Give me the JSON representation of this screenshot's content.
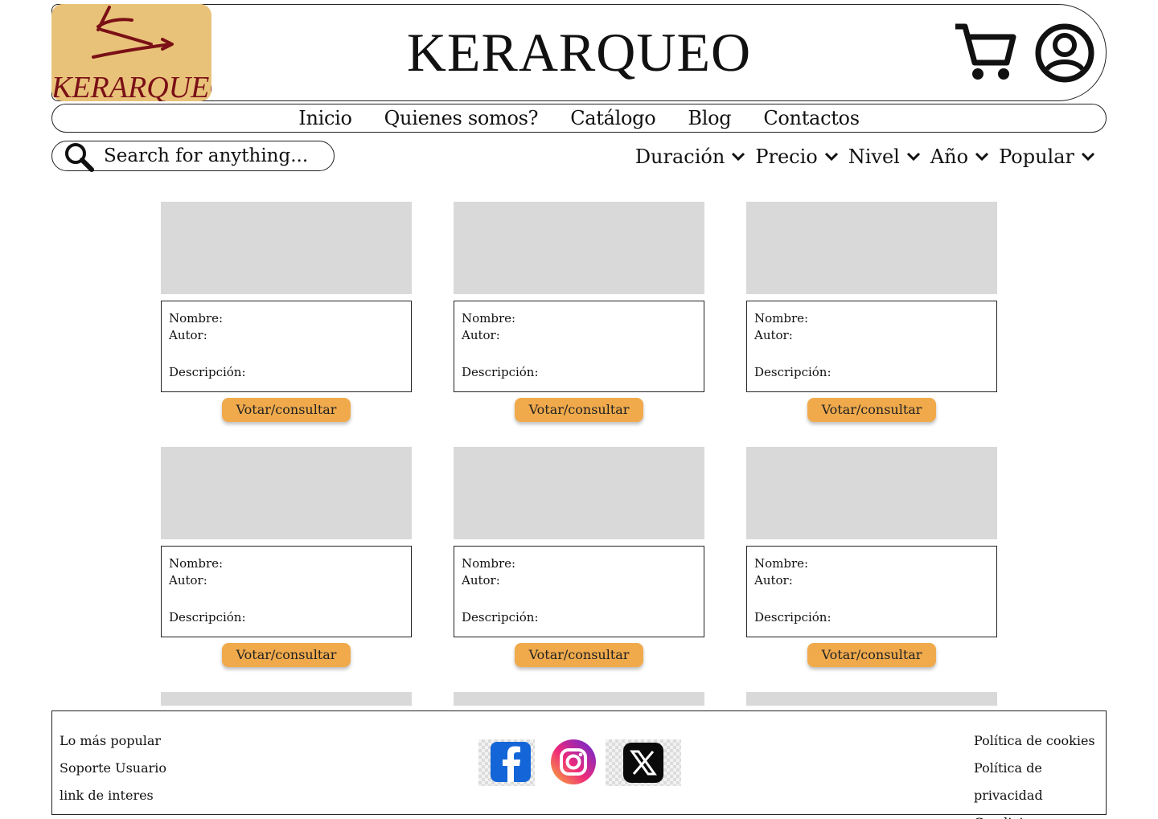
{
  "header": {
    "logo_text": "KERARQUEO",
    "title": "KERARQUEO",
    "cart_icon": "cart-icon",
    "account_icon": "account-icon"
  },
  "nav": {
    "items": [
      {
        "label": "Inicio"
      },
      {
        "label": "Quienes somos?"
      },
      {
        "label": "Catálogo"
      },
      {
        "label": "Blog"
      },
      {
        "label": "Contactos"
      }
    ]
  },
  "search": {
    "placeholder": "Search for anything...",
    "icon": "search-icon"
  },
  "filters": [
    {
      "label": "Duración"
    },
    {
      "label": "Precio"
    },
    {
      "label": "Nivel"
    },
    {
      "label": "Año"
    },
    {
      "label": "Popular"
    }
  ],
  "cards": [
    {
      "name_label": "Nombre:",
      "author_label": "Autor:",
      "desc_label": "Descripción:",
      "button": "Votar/consultar"
    },
    {
      "name_label": "Nombre:",
      "author_label": "Autor:",
      "desc_label": "Descripción:",
      "button": "Votar/consultar"
    },
    {
      "name_label": "Nombre:",
      "author_label": "Autor:",
      "desc_label": "Descripción:",
      "button": "Votar/consultar"
    },
    {
      "name_label": "Nombre:",
      "author_label": "Autor:",
      "desc_label": "Descripción:",
      "button": "Votar/consultar"
    },
    {
      "name_label": "Nombre:",
      "author_label": "Autor:",
      "desc_label": "Descripción:",
      "button": "Votar/consultar"
    },
    {
      "name_label": "Nombre:",
      "author_label": "Autor:",
      "desc_label": "Descripción:",
      "button": "Votar/consultar"
    }
  ],
  "footer": {
    "left_links": [
      {
        "label": "Lo más popular"
      },
      {
        "label": "Soporte Usuario"
      },
      {
        "label": "link de interes"
      }
    ],
    "right_links": [
      {
        "label": "Política de cookies"
      },
      {
        "label": "Política de privacidad"
      },
      {
        "label": "Condiciones"
      }
    ],
    "social": [
      "facebook-icon",
      "instagram-icon",
      "x-icon"
    ]
  },
  "colors": {
    "logo_bg": "#e9c27a",
    "logo_ink": "#7a1016",
    "button": "#f0aa4c",
    "placeholder_image": "#d9d9d9"
  }
}
